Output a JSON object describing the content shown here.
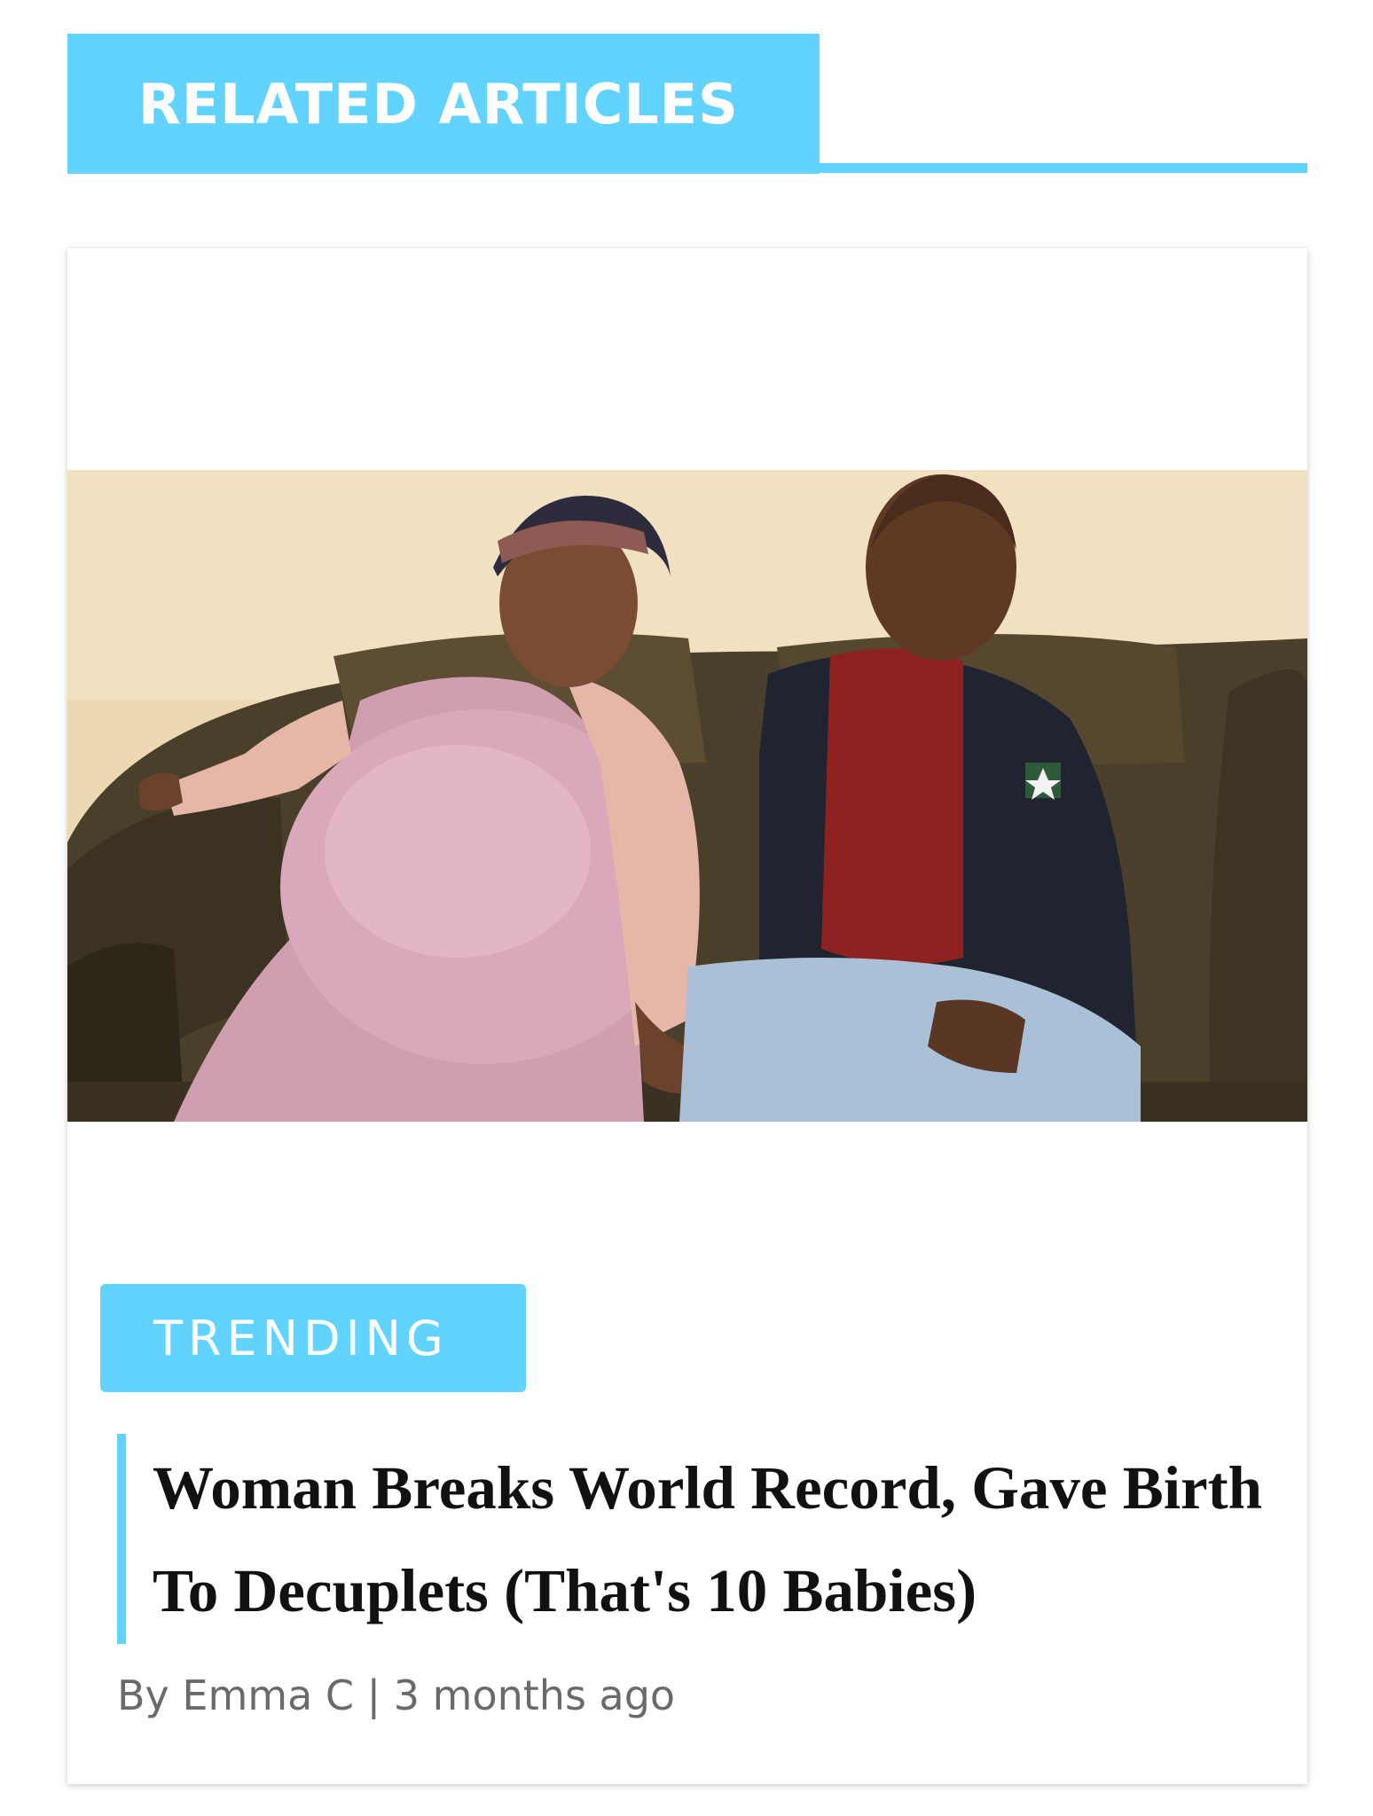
{
  "section": {
    "title": "RELATED ARTICLES",
    "accent_color": "#62d3fe"
  },
  "article": {
    "category": "TRENDING",
    "headline": "Woman Breaks World Record, Gave Birth To Decuplets (That's 10 Babies)",
    "author": "By Emma C",
    "separator": "|",
    "time_ago": "3 months ago",
    "image_alt": "Pregnant woman in pink dress and headwrap seated on a brown leather couch beside a smiling man in a dark jacket and red polo shirt"
  }
}
